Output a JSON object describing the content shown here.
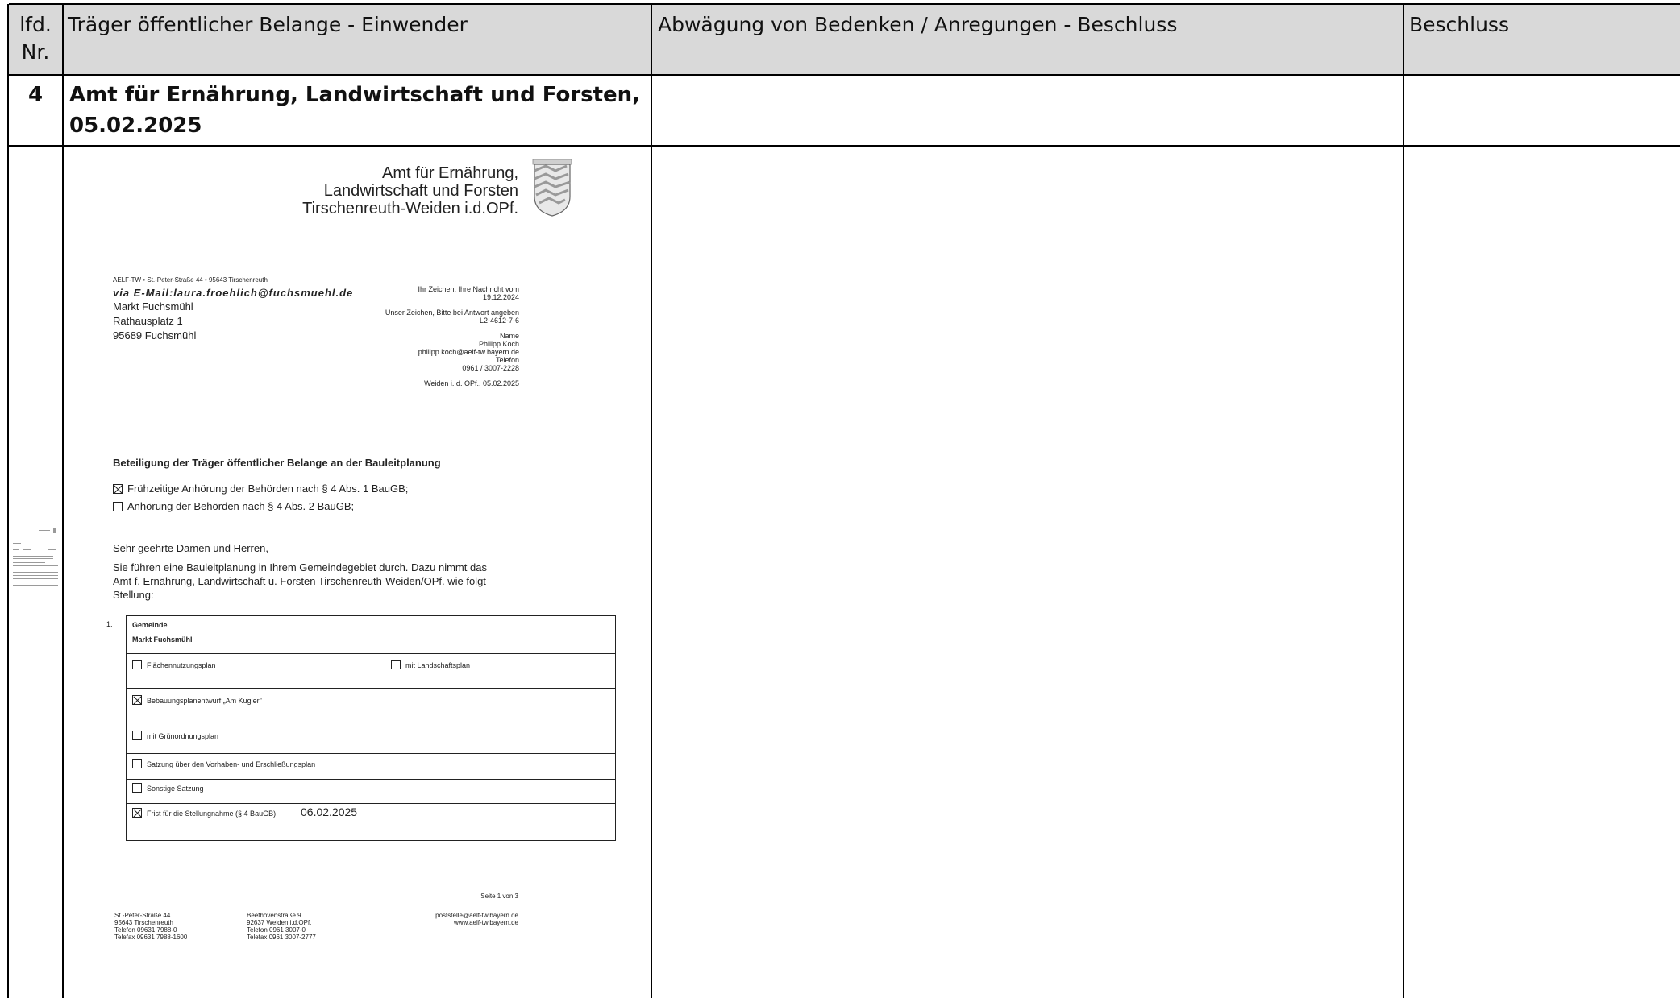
{
  "table": {
    "header": {
      "nr": "lfd.\nNr.",
      "traeger": "Träger öffentlicher Belange - Einwender",
      "abwaegung": "Abwägung von Bedenken / Anregungen - Beschluss",
      "beschluss": "Beschluss"
    },
    "entry": {
      "number": "4",
      "title": "Amt für Ernährung, Landwirtschaft und Forsten,",
      "date": "05.02.2025"
    }
  },
  "letter": {
    "authority": [
      "Amt für Ernährung,",
      "Landwirtschaft und Forsten",
      "Tirschenreuth-Weiden i.d.OPf."
    ],
    "sender_line": "AELF-TW • St.-Peter-Straße 44 • 95643 Tirschenreuth",
    "via_email": "via E-Mail:laura.froehlich@fuchsmuehl.de",
    "recipient": [
      "Markt Fuchsmühl",
      "Rathausplatz 1",
      "95689 Fuchsmühl"
    ],
    "meta": {
      "ihr_zeichen_label": "Ihr Zeichen, Ihre Nachricht vom",
      "ihr_zeichen_value": "19.12.2024",
      "unser_zeichen_label": "Unser Zeichen, Bitte bei Antwort angeben",
      "unser_zeichen_value": "L2-4612-7-6",
      "name_label": "Name",
      "name_value": "Philipp Koch",
      "email_value": "philipp.koch@aelf-tw.bayern.de",
      "telefon_label": "Telefon",
      "telefon_value": "0961 / 3007-2228",
      "place_date": "Weiden i. d. OPf., 05.02.2025"
    },
    "subject": "Beteiligung der Träger öffentlicher Belange an der Bauleitplanung",
    "options": [
      {
        "label": "Frühzeitige Anhörung der Behörden nach § 4 Abs. 1 BauGB;",
        "checked": true
      },
      {
        "label": "Anhörung der Behörden nach § 4 Abs. 2 BauGB;",
        "checked": false
      }
    ],
    "salutation": "Sehr geehrte Damen und Herren,",
    "body": [
      "Sie führen eine Bauleitplanung in Ihrem Gemeindegebiet durch. Dazu nimmt das",
      "Amt f. Ernährung, Landwirtschaft u. Forsten Tirschenreuth-Weiden/OPf. wie folgt",
      "Stellung:"
    ],
    "form": {
      "number": "1.",
      "gemeinde_label": "Gemeinde",
      "gemeinde_value": "Markt Fuchsmühl",
      "fnp": "Flächennutzungsplan",
      "landschaftsplan": "mit Landschaftsplan",
      "bebauungsplan": "Bebauungsplanentwurf  „Am Kugler\"",
      "gruenordnung": "mit Grünordnungsplan",
      "satzung_vorhaben": "Satzung über den Vorhaben- und Erschließungsplan",
      "sonstige": "Sonstige Satzung",
      "frist_label": "Frist für die Stellungnahme (§ 4 BauGB)",
      "frist_value": "06.02.2025"
    },
    "page": "Seite 1 von 3",
    "footer": {
      "col1": [
        "St.-Peter-Straße 44",
        "95643 Tirschenreuth",
        "Telefon 09631 7988-0",
        "Telefax 09631 7988-1600"
      ],
      "col2": [
        "Beethovenstraße 9",
        "92637 Weiden i.d.OPf.",
        "Telefon 0961 3007-0",
        "Telefax 0961 3007-2777"
      ],
      "col3": [
        "poststelle@aelf-tw.bayern.de",
        "www.aelf-tw.bayern.de"
      ]
    }
  }
}
